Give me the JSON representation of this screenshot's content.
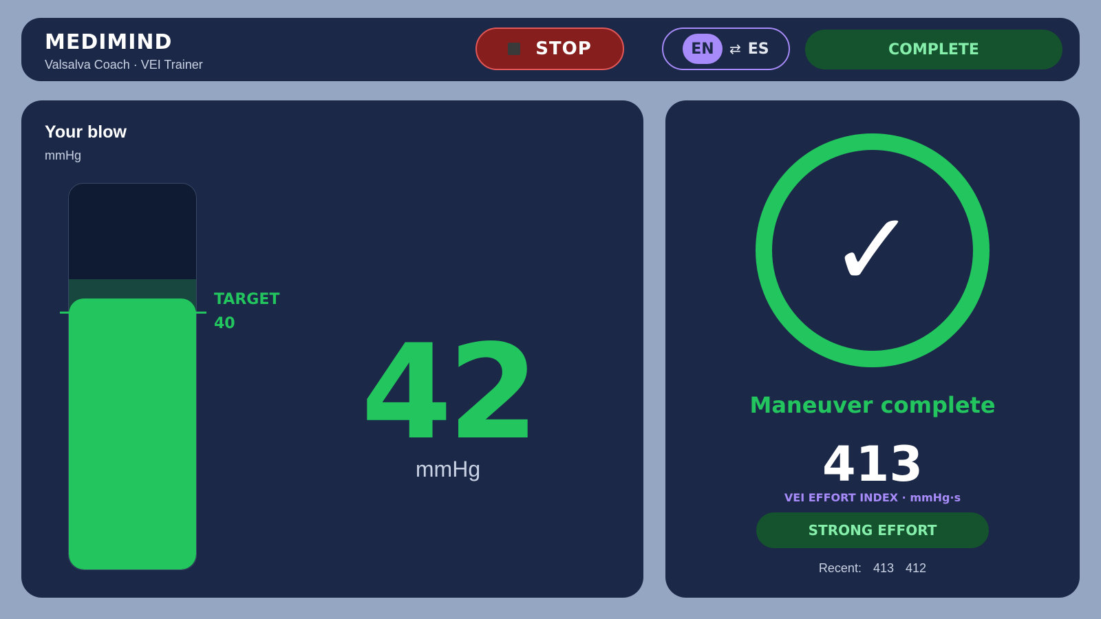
{
  "header": {
    "brand": "MEDIMIND",
    "subtitle": "Valsalva Coach · VEI Trainer",
    "stop_label": "STOP",
    "lang_current": "EN",
    "lang_swap_icon": "⇄",
    "lang_other": "ES",
    "status_label": "COMPLETE"
  },
  "gauge_panel": {
    "title": "Your blow",
    "unit": "mmHg",
    "target_label": "TARGET",
    "target_value": "40",
    "reading": "42",
    "reading_unit": "mmHg",
    "gauge_max_mmHg": 60,
    "target_mmHg": 40,
    "reading_mmHg": 42,
    "target_band_mmHg": [
      40,
      45
    ]
  },
  "result_panel": {
    "check_icon": "✓",
    "title": "Maneuver complete",
    "score": "413",
    "score_label": "VEI EFFORT INDEX · mmHg·s",
    "effort_label": "STRONG EFFORT",
    "recent_label": "Recent:",
    "recent": [
      "413",
      "412"
    ]
  },
  "colors": {
    "background": "#94a6c2",
    "card": "#1c2847",
    "success": "#22c55e",
    "success_dark": "#14532d",
    "danger": "#861e1e",
    "accent": "#a78bfa"
  }
}
